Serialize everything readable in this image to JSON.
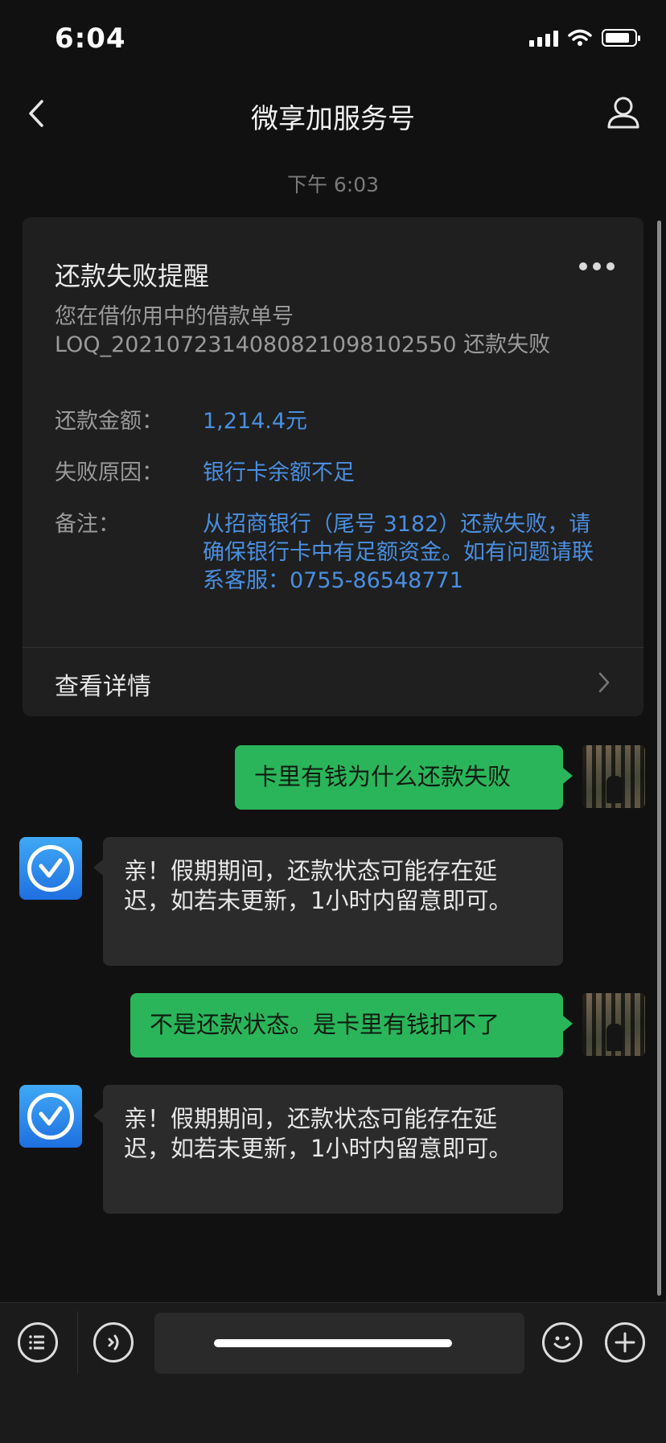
{
  "status_bar": {
    "time": "6:04",
    "battery_percent": 85
  },
  "nav": {
    "title": "微享加服务号"
  },
  "timestamp": "下午 6:03",
  "card": {
    "title": "还款失败提醒",
    "desc": "您在借你用中的借款单号 LOQ_2021072314080821098102550 还款失败",
    "rows": [
      {
        "label": "还款金额：",
        "value": "1,214.4元"
      },
      {
        "label": "失败原因：",
        "value": "银行卡余额不足"
      },
      {
        "label": "备注：",
        "value": "从招商银行（尾号 3182）还款失败，请确保银行卡中有足额资金。如有问题请联系客服：0755-86548771"
      }
    ],
    "footer_label": "查看详情"
  },
  "messages": [
    {
      "from": "user",
      "text": "卡里有钱为什么还款失败"
    },
    {
      "from": "bot",
      "text": "亲！假期期间，还款状态可能存在延迟，如若未更新，1小时内留意即可。"
    },
    {
      "from": "user",
      "text": "不是还款状态。是卡里有钱扣不了"
    },
    {
      "from": "bot",
      "text": "亲！假期期间，还款状态可能存在延迟，如若未更新，1小时内留意即可。"
    }
  ],
  "colors": {
    "accent_green": "#2ab55a",
    "link_blue": "#4a8fe0",
    "background": "#111111"
  },
  "icons": {
    "back": "chevron-left-icon",
    "profile": "person-icon",
    "more": "ellipsis-icon",
    "menu": "menu-list-icon",
    "voice": "voice-icon",
    "emoji": "emoji-icon",
    "add": "plus-icon"
  }
}
